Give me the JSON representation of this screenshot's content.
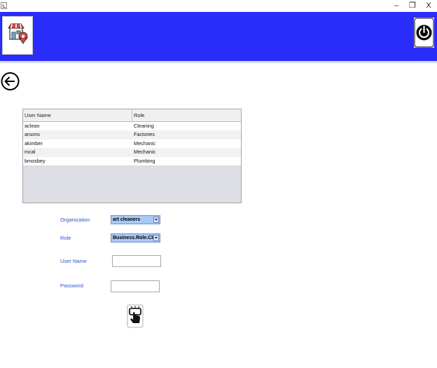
{
  "window": {
    "controls": {
      "minimize": "–",
      "restore": "❐",
      "close": "X"
    }
  },
  "header": {
    "logo_icon": "store-location-icon",
    "power_icon": "power-icon",
    "brand_color": "#2a2cf9"
  },
  "nav": {
    "back_icon": "back-arrow-icon"
  },
  "table": {
    "columns": [
      "User Name",
      "Role"
    ],
    "rows": [
      [
        "aclean",
        "Cleaning"
      ],
      [
        "arsons",
        "Factories"
      ],
      [
        "akimber",
        "Mechanic"
      ],
      [
        "mcal",
        "Mechanic"
      ],
      [
        "bmosbey",
        "Plumbing"
      ]
    ]
  },
  "form": {
    "organization_label": "Organization",
    "organization_value": "art cleaners",
    "role_label": "Role",
    "role_value": "Business.Role.Clea...",
    "username_label": "User Name",
    "username_value": "",
    "password_label": "Password",
    "password_value": "",
    "submit_icon": "hand-press-button-icon"
  }
}
